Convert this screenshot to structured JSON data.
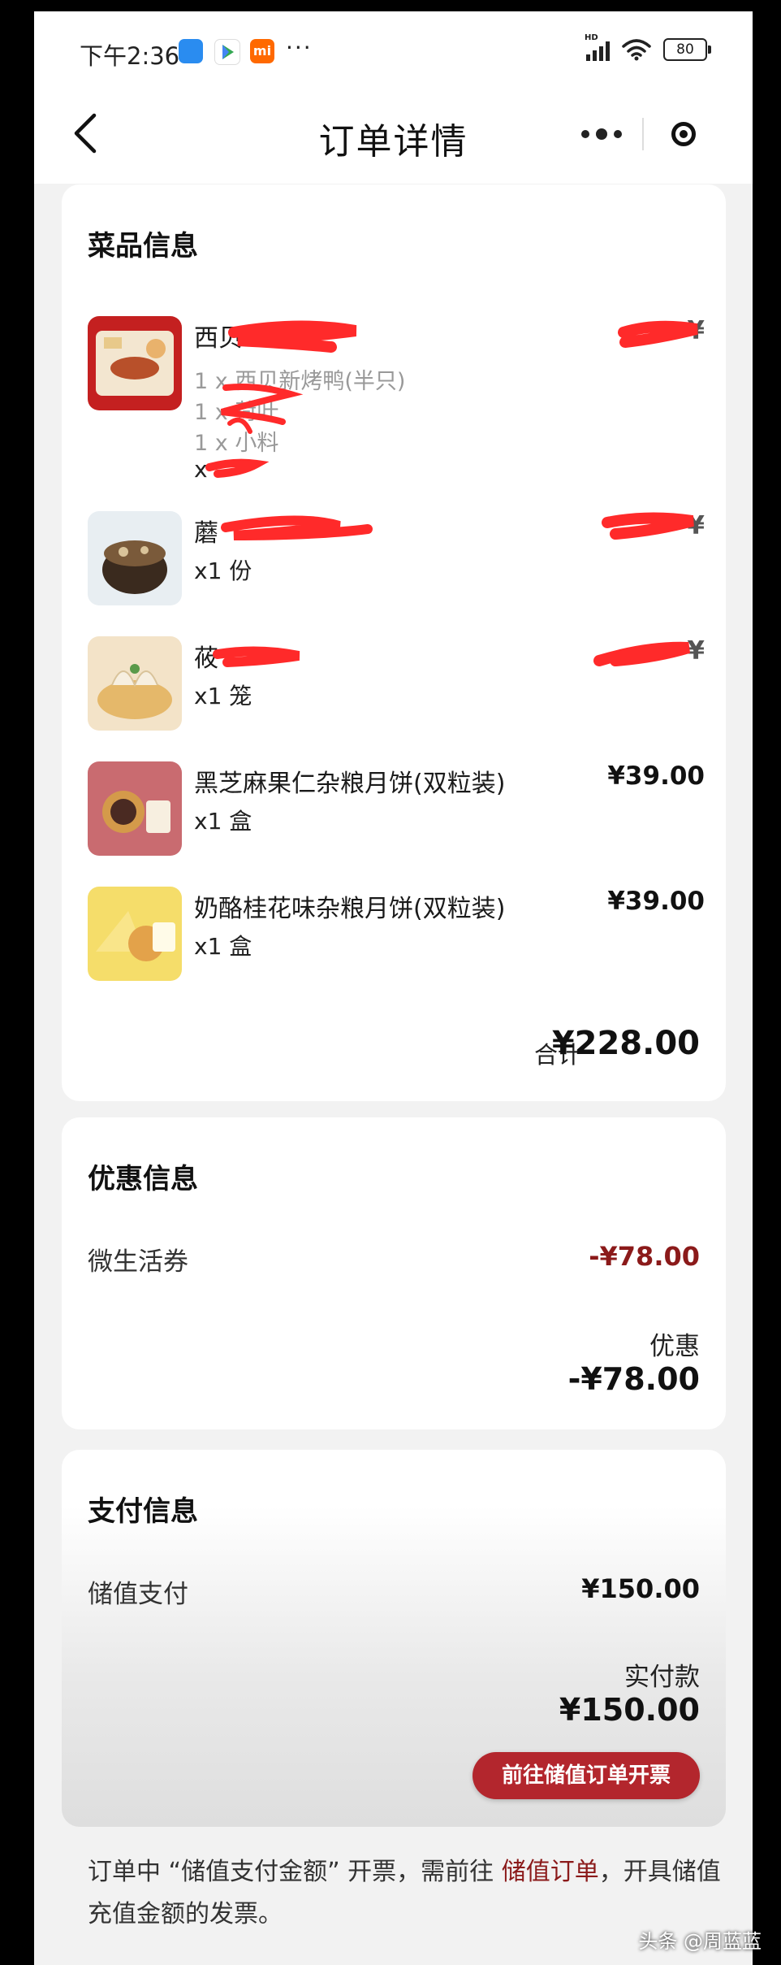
{
  "status_bar": {
    "time": "下午2:36",
    "more": "···",
    "battery": "80"
  },
  "nav": {
    "title": "订单详情"
  },
  "dish_card": {
    "title": "菜品信息",
    "items": [
      {
        "name": "西贝",
        "qty": "x",
        "price": "¥",
        "subs": [
          "1 x 西贝新烤鸭(半只)",
          "1 x 荷叶",
          "1 x 小料"
        ]
      },
      {
        "name": "蘑",
        "qty": "x1 份",
        "price": "¥"
      },
      {
        "name": "莜",
        "qty": "x1 笼",
        "price": "¥"
      },
      {
        "name": "黑芝麻果仁杂粮月饼(双粒装)",
        "qty": "x1 盒",
        "price": "¥39.00"
      },
      {
        "name": "奶酪桂花味杂粮月饼(双粒装)",
        "qty": "x1 盒",
        "price": "¥39.00"
      }
    ],
    "total_label": "合计",
    "total_value": "¥228.00"
  },
  "discount_card": {
    "title": "优惠信息",
    "coupon_label": "微生活券",
    "coupon_value": "-¥78.00",
    "summary_label": "优惠",
    "summary_value": "-¥78.00"
  },
  "payment_card": {
    "title": "支付信息",
    "method_label": "储值支付",
    "method_value": "¥150.00",
    "paid_label": "实付款",
    "paid_value": "¥150.00",
    "invoice_button": "前往储值订单开票"
  },
  "footer": {
    "note_part1": "订单中 “储值支付金额” 开票，需前往 ",
    "note_link": "储值订单",
    "note_part2": "，开具储值充值金额的发票。"
  },
  "watermark": "头条 @周蓝蓝",
  "colors": {
    "accent": "#b3262d",
    "negative": "#8b1a1a",
    "redaction": "#ff2a2a"
  }
}
